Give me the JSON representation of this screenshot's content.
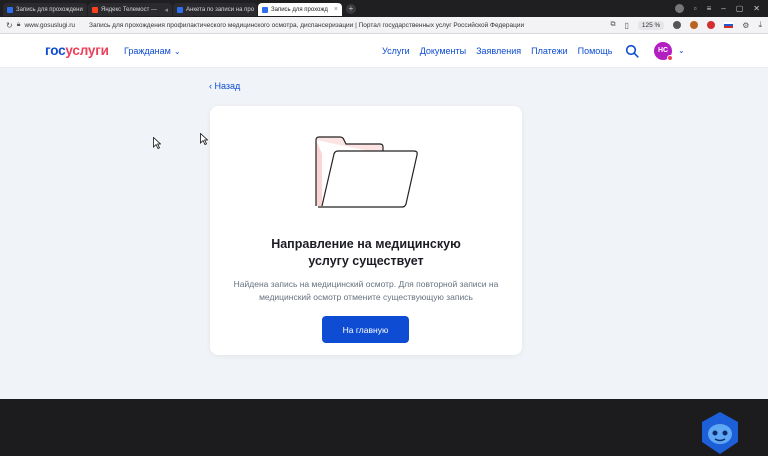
{
  "browser": {
    "tabs": [
      {
        "label": "Запись для прохождени"
      },
      {
        "label": "Яндекс Телемост —"
      },
      {
        "label": "Анкета по записи на про"
      },
      {
        "label": "Запись для прохожд"
      }
    ],
    "new_tab": "+",
    "url": "www.gosuslugi.ru",
    "page_title": "Запись для прохождения профилактического медицинского осмотра, диспансеризации | Портал государственных услуг Российской Федерации",
    "zoom": "125 %"
  },
  "header": {
    "logo_part1": "гос",
    "logo_part2": "услуги",
    "citizens": "Гражданам",
    "nav": [
      "Услуги",
      "Документы",
      "Заявления",
      "Платежи",
      "Помощь"
    ],
    "avatar_initials": "НС"
  },
  "main": {
    "back": "Назад",
    "title": "Направление на медицинскую услугу существует",
    "text": "Найдена запись на медицинский осмотр. Для повторной записи на медицинский осмотр отмените существующую запись",
    "button": "На главную"
  },
  "colors": {
    "brand_blue": "#0d4cd3",
    "brand_red": "#ee3f58",
    "background": "#f0f3f7"
  },
  "icons": [
    "reload-icon",
    "lock-icon",
    "search-icon",
    "chevron-down-icon",
    "chevron-left-icon",
    "folder-illustration",
    "bot-assistant-icon"
  ]
}
